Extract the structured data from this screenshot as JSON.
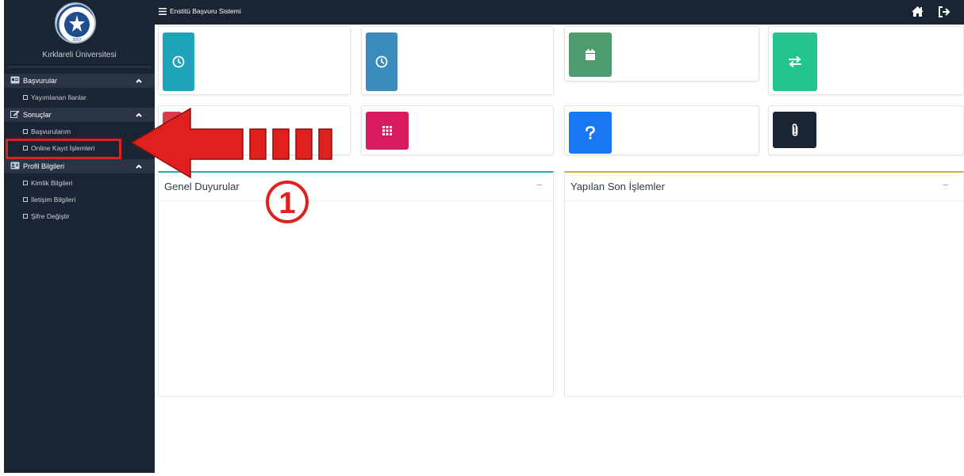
{
  "app": {
    "title": "Enstitü Başvuru Sistemi"
  },
  "sidebar": {
    "university_name": "Kırklareli Üniversitesi",
    "sections": [
      {
        "label": "Başvurular",
        "icon": "id-card-icon",
        "items": [
          {
            "label": "Yayımlanan İlanlar"
          }
        ]
      },
      {
        "label": "Sonuçlar",
        "icon": "edit-icon",
        "items": [
          {
            "label": "Başvurularım"
          },
          {
            "label": "Online Kayıt İşlemleri",
            "highlighted": true
          }
        ]
      },
      {
        "label": "Profil Bilgileri",
        "icon": "id-badge-icon",
        "items": [
          {
            "label": "Kimlik Bilgileri"
          },
          {
            "label": "İletişim Bilgileri"
          },
          {
            "label": "Şifre Değiştir"
          }
        ]
      }
    ]
  },
  "topbar": {
    "icons": [
      "menu-icon",
      "home-icon",
      "logout-icon"
    ]
  },
  "cards": [
    {
      "icon": "clock-icon",
      "color": "#1fa3b8"
    },
    {
      "icon": "clock-icon",
      "color": "#3b8bbd"
    },
    {
      "icon": "calendar-icon",
      "color": "#4d9c6e"
    },
    {
      "icon": "exchange-icon",
      "color": "#22c590"
    },
    {
      "icon": "unknown-icon",
      "color": "#d73c4c"
    },
    {
      "icon": "grid-icon",
      "color": "#d81b60"
    },
    {
      "icon": "question-icon",
      "color": "#1877f2"
    },
    {
      "icon": "paperclip-icon",
      "color": "#1b2433"
    }
  ],
  "panels": {
    "announcements": {
      "title": "Genel Duyurular",
      "collapse": "−",
      "accent": "#18b3c9"
    },
    "recent": {
      "title": "Yapılan Son İşlemler",
      "collapse": "−",
      "accent": "#e8a829"
    }
  },
  "annotation": {
    "number": "①",
    "color": "#e0201c"
  }
}
